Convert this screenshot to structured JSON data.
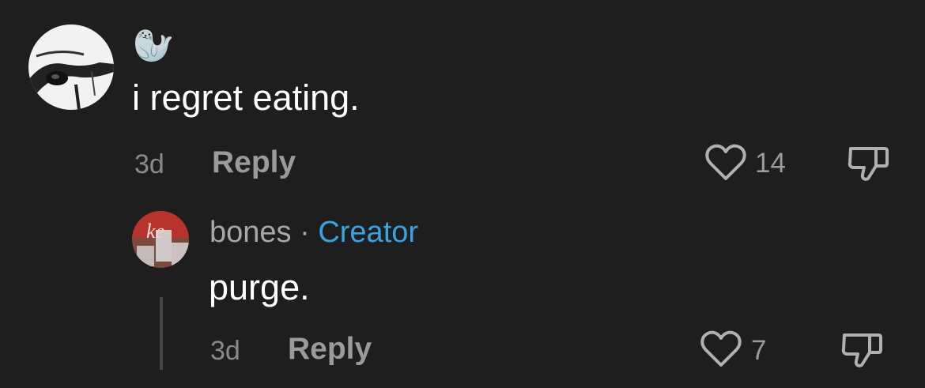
{
  "comment": {
    "emoji": "🦭",
    "text": "i regret eating.",
    "time": "3d",
    "reply_label": "Reply",
    "like_count": "14",
    "icons": {
      "like": "heart-icon",
      "dislike": "thumbs-down-icon"
    }
  },
  "reply": {
    "author": "bones",
    "separator": "·",
    "badge": "Creator",
    "badge_color": "#3aa3de",
    "text": "purge.",
    "time": "3d",
    "reply_label": "Reply",
    "like_count": "7",
    "icons": {
      "like": "heart-icon",
      "dislike": "thumbs-down-icon"
    }
  },
  "avatar_logo_text": "ke"
}
